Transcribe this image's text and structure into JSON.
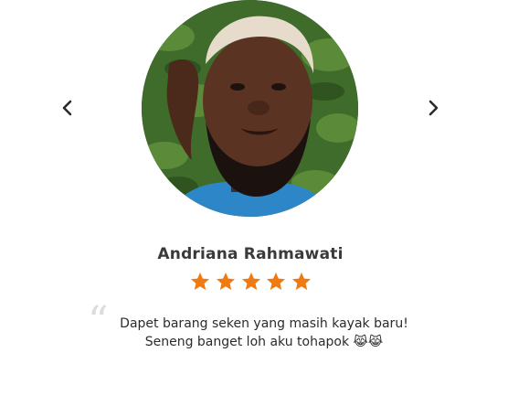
{
  "testimonial": {
    "name": "Andriana Rahmawati",
    "rating": 5,
    "quote_mark": "“",
    "review_lines": [
      "Dapet barang seken yang masih kayak baru!",
      "Seneng banget loh aku tohapok 😹😹"
    ]
  },
  "navigation": {
    "prev_icon": "chevron-left-icon",
    "next_icon": "chevron-right-icon"
  },
  "colors": {
    "star": "#F07A12",
    "name": "#3a3a3a",
    "text": "#2b2b2b",
    "quote_mark": "#dcdcdc"
  },
  "avatar": {
    "icon": "avatar-photo"
  }
}
